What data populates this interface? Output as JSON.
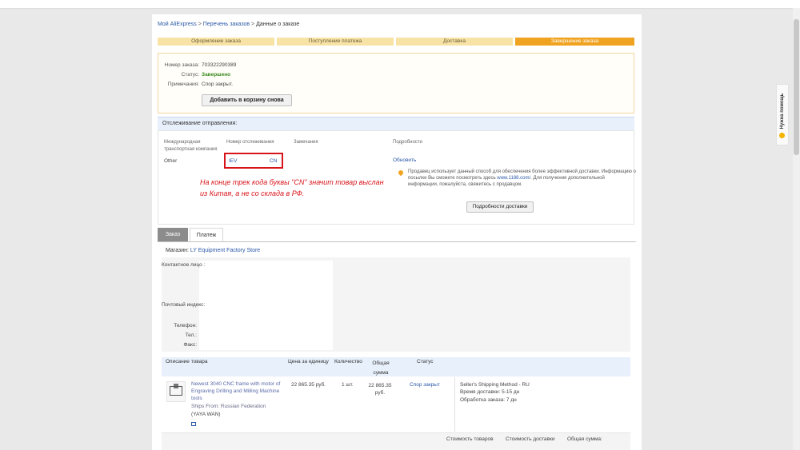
{
  "breadcrumb": {
    "items": [
      "Мой AliExpress",
      "Перечень заказов",
      "Данные о заказе"
    ],
    "separator": ">"
  },
  "steps": [
    "Оформление заказа",
    "Поступление платежа",
    "Доставка",
    "Завершение заказа"
  ],
  "order": {
    "number_label": "Номер заказа:",
    "number_value": "703322290389",
    "status_label": "Статус:",
    "status_value": "Завершено",
    "note_label": "Примечания:",
    "note_value": "Спор закрыт.",
    "add_to_cart": "Добавить в корзину снова"
  },
  "tracking": {
    "title": "Отслеживание отправления:",
    "col_carrier": "Международная транспортная компания",
    "col_tracking": "Номер отслеживания",
    "col_remarks": "Замечания",
    "col_details": "Подробности",
    "carrier_value": "Other",
    "track_start": "IEV",
    "track_end": "CN",
    "refresh": "Обновить",
    "info_text": "Продавец использует данный способ для обеспечения более эффективной доставки. Информацию о посылке Вы сможете посмотреть здесь",
    "info_link": "www.1188.com/",
    "info_text2": ". Для получения дополнительной информации, пожалуйста, свяжитесь с продавцом.",
    "details_button": "Подробности доставки"
  },
  "annotation": "На конце трек кода буквы \"CN\" значит товар выслан из Китая, а не со склада в РФ.",
  "tabs": [
    "Заказ",
    "Платеж"
  ],
  "store": {
    "label": "Магазин:",
    "name": "LY Equipment Factory Store"
  },
  "address_labels": [
    "Контактное лицо :",
    "Почтовый индекс:",
    "Телефон:",
    "Тел.:",
    "Факс:"
  ],
  "products": {
    "headers": [
      "Описание товара",
      "Цена за единицу",
      "Количество",
      "Общая сумма",
      "Статус"
    ],
    "item": {
      "title": "Newest 3040 CNC frame with motor of Engraving Drilling and Milling Machine tools",
      "ships_from": "Ships From: Russian Federation",
      "seller": "(YAYA WAN)",
      "price": "22 865.35 руб.",
      "quantity": "1 шт.",
      "total": "22 865.35 руб.",
      "status": "Спор закрыт",
      "shipping_method": "Seller's Shipping Method - RU",
      "delivery_time": "Время доставки: 5-15 дн",
      "processing_time": "Обработка заказа: 7 дн"
    },
    "footer": [
      "Стоимость товаров",
      "Стоимость доставки",
      "Общая сумма:"
    ]
  },
  "help": {
    "label": "Нужна помощь"
  },
  "colors": {
    "step_active": "#f0a321",
    "step_inactive": "#f8e3a6",
    "link": "#2a58a8",
    "annotation": "#d8141b",
    "status_ok": "#3a8a1e"
  }
}
